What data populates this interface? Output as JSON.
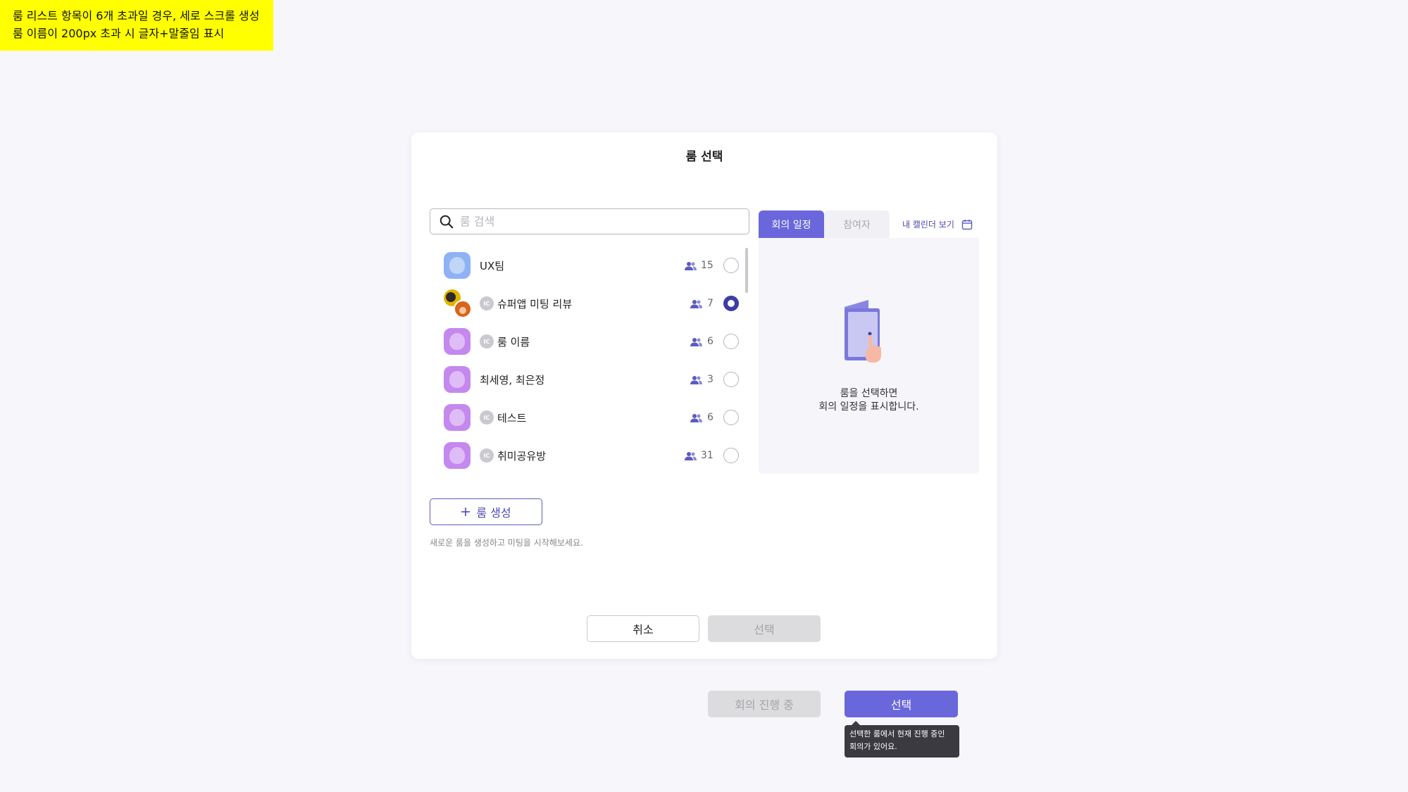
{
  "note": {
    "line1": "룸 리스트 항목이 6개 초과일 경우, 세로 스크롤 생성",
    "line2": "룸 이름이 200px 초과 시 글자+말줄임 표시"
  },
  "modal": {
    "title": "룸 선택",
    "search_placeholder": "룸 검색",
    "rooms": [
      {
        "name": "UX팀",
        "members": "15",
        "badge": "",
        "avatar": "blue",
        "selected": false
      },
      {
        "name": "슈퍼앱 미팅 리뷰",
        "members": "7",
        "badge": "IC",
        "avatar": "photos",
        "selected": true
      },
      {
        "name": "룸 이름",
        "members": "6",
        "badge": "IC",
        "avatar": "purple",
        "selected": false
      },
      {
        "name": "최세영, 최은정",
        "members": "3",
        "badge": "",
        "avatar": "purple",
        "selected": false
      },
      {
        "name": "테스트",
        "members": "6",
        "badge": "IC",
        "avatar": "purple",
        "selected": false
      },
      {
        "name": "취미공유방",
        "members": "31",
        "badge": "IC",
        "avatar": "purple",
        "selected": false
      }
    ],
    "tabs": [
      {
        "label": "회의 일정",
        "active": true
      },
      {
        "label": "참여자",
        "active": false
      }
    ],
    "calendar_link": "내 캘린더 보기",
    "panel_message_line1": "룸을 선택하면",
    "panel_message_line2": "회의 일정을 표시합니다.",
    "create_button": "룸 생성",
    "create_hint": "새로운 룸을 생성하고 미팅을 시작해보세요.",
    "cancel_button": "취소",
    "select_button": "선택"
  },
  "bottom": {
    "in_progress_button": "회의 진행 중",
    "select_button": "선택",
    "tooltip_line1": "선택한 룸에서 현재 진행 중인",
    "tooltip_line2": "회의가 있어요."
  },
  "colors": {
    "accent": "#6a67dc",
    "accent_dark": "#3c3da8",
    "avatar_blue": "#8fb2f5",
    "avatar_purple": "#c488ee",
    "note_bg": "#ffff00"
  }
}
